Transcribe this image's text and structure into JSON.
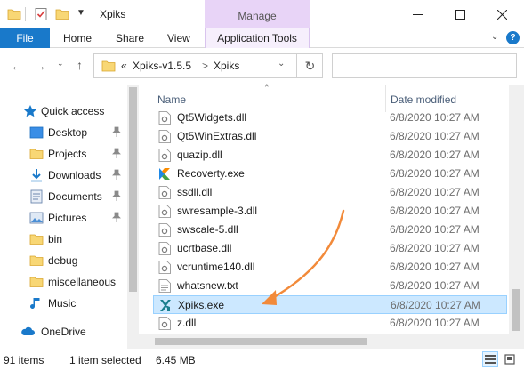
{
  "window": {
    "title": "Xpiks",
    "contextual_tab_group": "Manage",
    "controls": [
      "minimize",
      "maximize",
      "close"
    ]
  },
  "ribbon": {
    "tabs": [
      "File",
      "Home",
      "Share",
      "View",
      "Application Tools"
    ],
    "active_tab": "File",
    "accent_color": "#1979ca",
    "contextual_color": "#e8d4f7"
  },
  "address": {
    "overflow": "«",
    "crumbs": [
      "Xpiks-v1.5.5",
      "Xpiks"
    ],
    "separator": ">",
    "search_placeholder": ""
  },
  "nav_pane": {
    "items": [
      {
        "label": "Quick access",
        "icon": "star-icon",
        "pinned": false
      },
      {
        "label": "Desktop",
        "icon": "desktop-icon",
        "pinned": true
      },
      {
        "label": "Projects",
        "icon": "folder-icon",
        "pinned": true
      },
      {
        "label": "Downloads",
        "icon": "download-icon",
        "pinned": true
      },
      {
        "label": "Documents",
        "icon": "documents-icon",
        "pinned": true
      },
      {
        "label": "Pictures",
        "icon": "pictures-icon",
        "pinned": true
      },
      {
        "label": "bin",
        "icon": "folder-icon",
        "pinned": false
      },
      {
        "label": "debug",
        "icon": "folder-icon",
        "pinned": false
      },
      {
        "label": "miscellaneous",
        "icon": "folder-icon",
        "pinned": false
      },
      {
        "label": "Music",
        "icon": "music-icon",
        "pinned": false
      },
      {
        "label": "OneDrive",
        "icon": "cloud-icon",
        "pinned": false
      }
    ]
  },
  "file_list": {
    "columns": [
      "Name",
      "Date modified"
    ],
    "sort_column": "Name",
    "rows": [
      {
        "name": "Qt5Widgets.dll",
        "date": "6/8/2020 10:27 AM",
        "icon": "dll-icon"
      },
      {
        "name": "Qt5WinExtras.dll",
        "date": "6/8/2020 10:27 AM",
        "icon": "dll-icon"
      },
      {
        "name": "quazip.dll",
        "date": "6/8/2020 10:27 AM",
        "icon": "dll-icon"
      },
      {
        "name": "Recoverty.exe",
        "date": "6/8/2020 10:27 AM",
        "icon": "recoverty-app-icon"
      },
      {
        "name": "ssdll.dll",
        "date": "6/8/2020 10:27 AM",
        "icon": "dll-icon"
      },
      {
        "name": "swresample-3.dll",
        "date": "6/8/2020 10:27 AM",
        "icon": "dll-icon"
      },
      {
        "name": "swscale-5.dll",
        "date": "6/8/2020 10:27 AM",
        "icon": "dll-icon"
      },
      {
        "name": "ucrtbase.dll",
        "date": "6/8/2020 10:27 AM",
        "icon": "dll-icon"
      },
      {
        "name": "vcruntime140.dll",
        "date": "6/8/2020 10:27 AM",
        "icon": "dll-icon"
      },
      {
        "name": "whatsnew.txt",
        "date": "6/8/2020 10:27 AM",
        "icon": "text-file-icon"
      },
      {
        "name": "Xpiks.exe",
        "date": "6/8/2020 10:27 AM",
        "icon": "xpiks-app-icon",
        "selected": true
      },
      {
        "name": "z.dll",
        "date": "6/8/2020 10:27 AM",
        "icon": "dll-icon"
      }
    ]
  },
  "status": {
    "item_count": "91 items",
    "selection": "1 item selected",
    "size": "6.45 MB"
  },
  "annotation": {
    "color": "#f28a3a",
    "target": "Xpiks.exe"
  }
}
